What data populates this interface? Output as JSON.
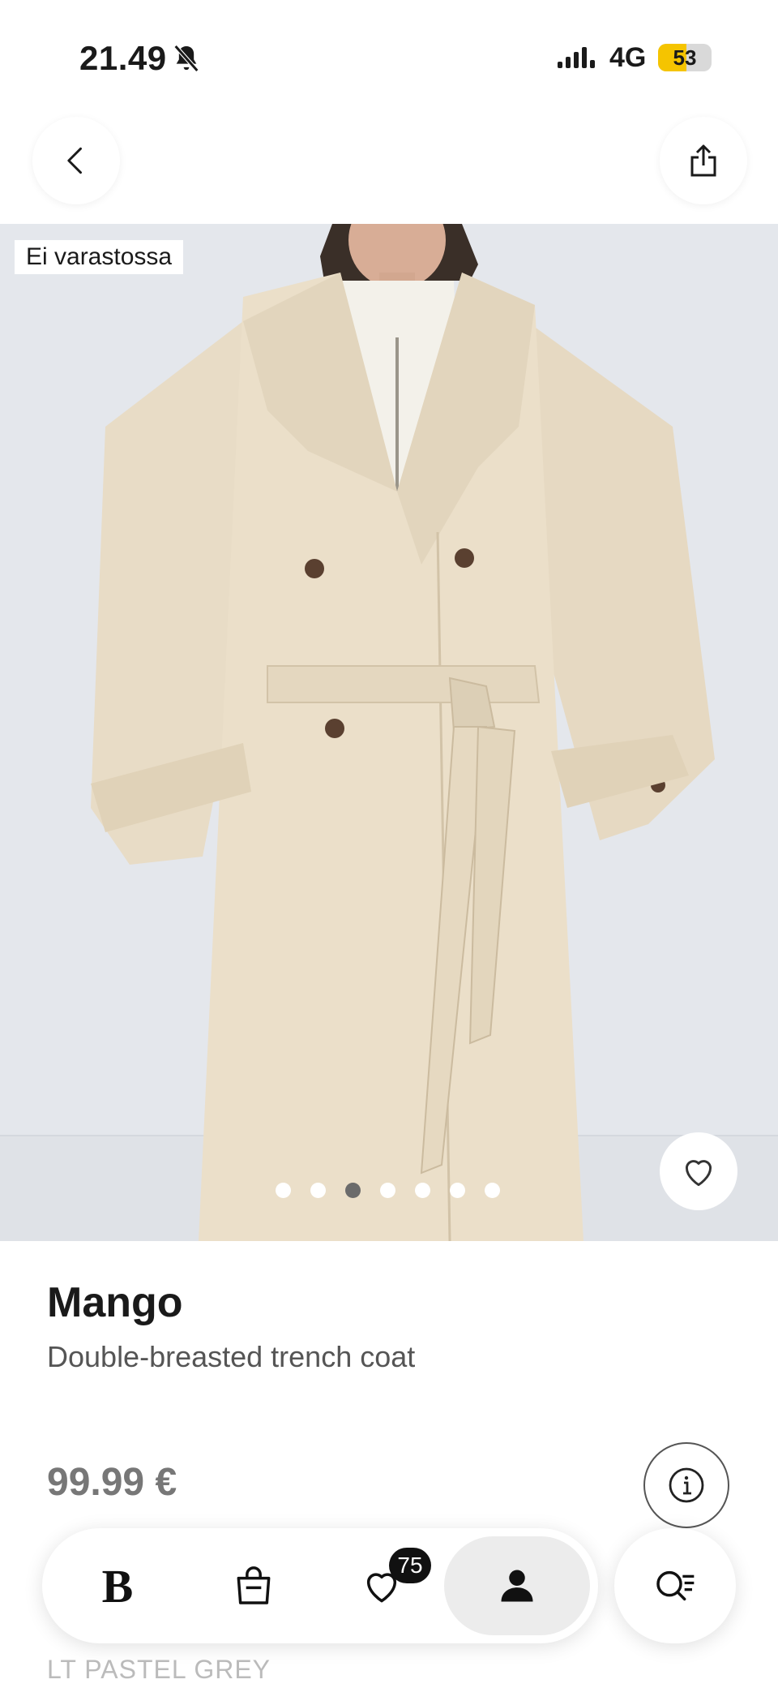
{
  "status_bar": {
    "time": "21.49",
    "network": "4G",
    "battery_level": "53",
    "battery_percent": 0.53,
    "icons": [
      "bell-slash-icon",
      "signal-icon"
    ]
  },
  "header": {
    "back_icon": "chevron-left-icon",
    "share_icon": "share-icon"
  },
  "gallery": {
    "stock_label": "Ei varastossa",
    "image_count": 7,
    "active_index": 2,
    "favorite_icon": "heart-icon"
  },
  "product": {
    "brand": "Mango",
    "name": "Double-breasted trench coat",
    "price": "99.99 €",
    "color": "LT PASTEL GREY",
    "info_icon": "info-icon"
  },
  "bottom_nav": {
    "home_label": "B",
    "bag_icon": "shopping-bag-icon",
    "favorites_icon": "heart-icon",
    "favorites_count": "75",
    "profile_icon": "user-icon",
    "search_icon": "search-list-icon"
  },
  "colors": {
    "battery_fill": "#f5c400",
    "coat": "#e8dcc6",
    "background_image": "#e6e9ee"
  }
}
